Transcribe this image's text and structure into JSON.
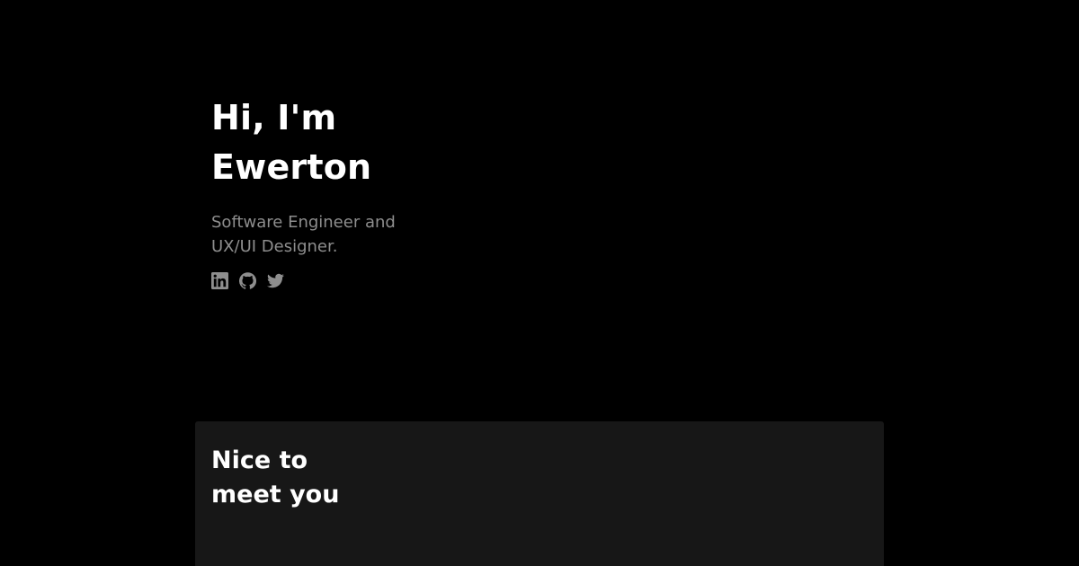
{
  "hero": {
    "title_lines": [
      "Hi, I'm",
      "Ewerton"
    ],
    "subtitle_lines": [
      "Software Engineer and",
      "UX/UI Designer."
    ],
    "social_links": [
      {
        "icon": "linkedin-icon"
      },
      {
        "icon": "github-icon"
      },
      {
        "icon": "twitter-icon"
      }
    ]
  },
  "card": {
    "title_lines": [
      "Nice to",
      "meet you"
    ]
  },
  "colors": {
    "background": "#000000",
    "card_background": "#171717",
    "heading": "#ffffff",
    "muted": "#8e8e8e"
  }
}
